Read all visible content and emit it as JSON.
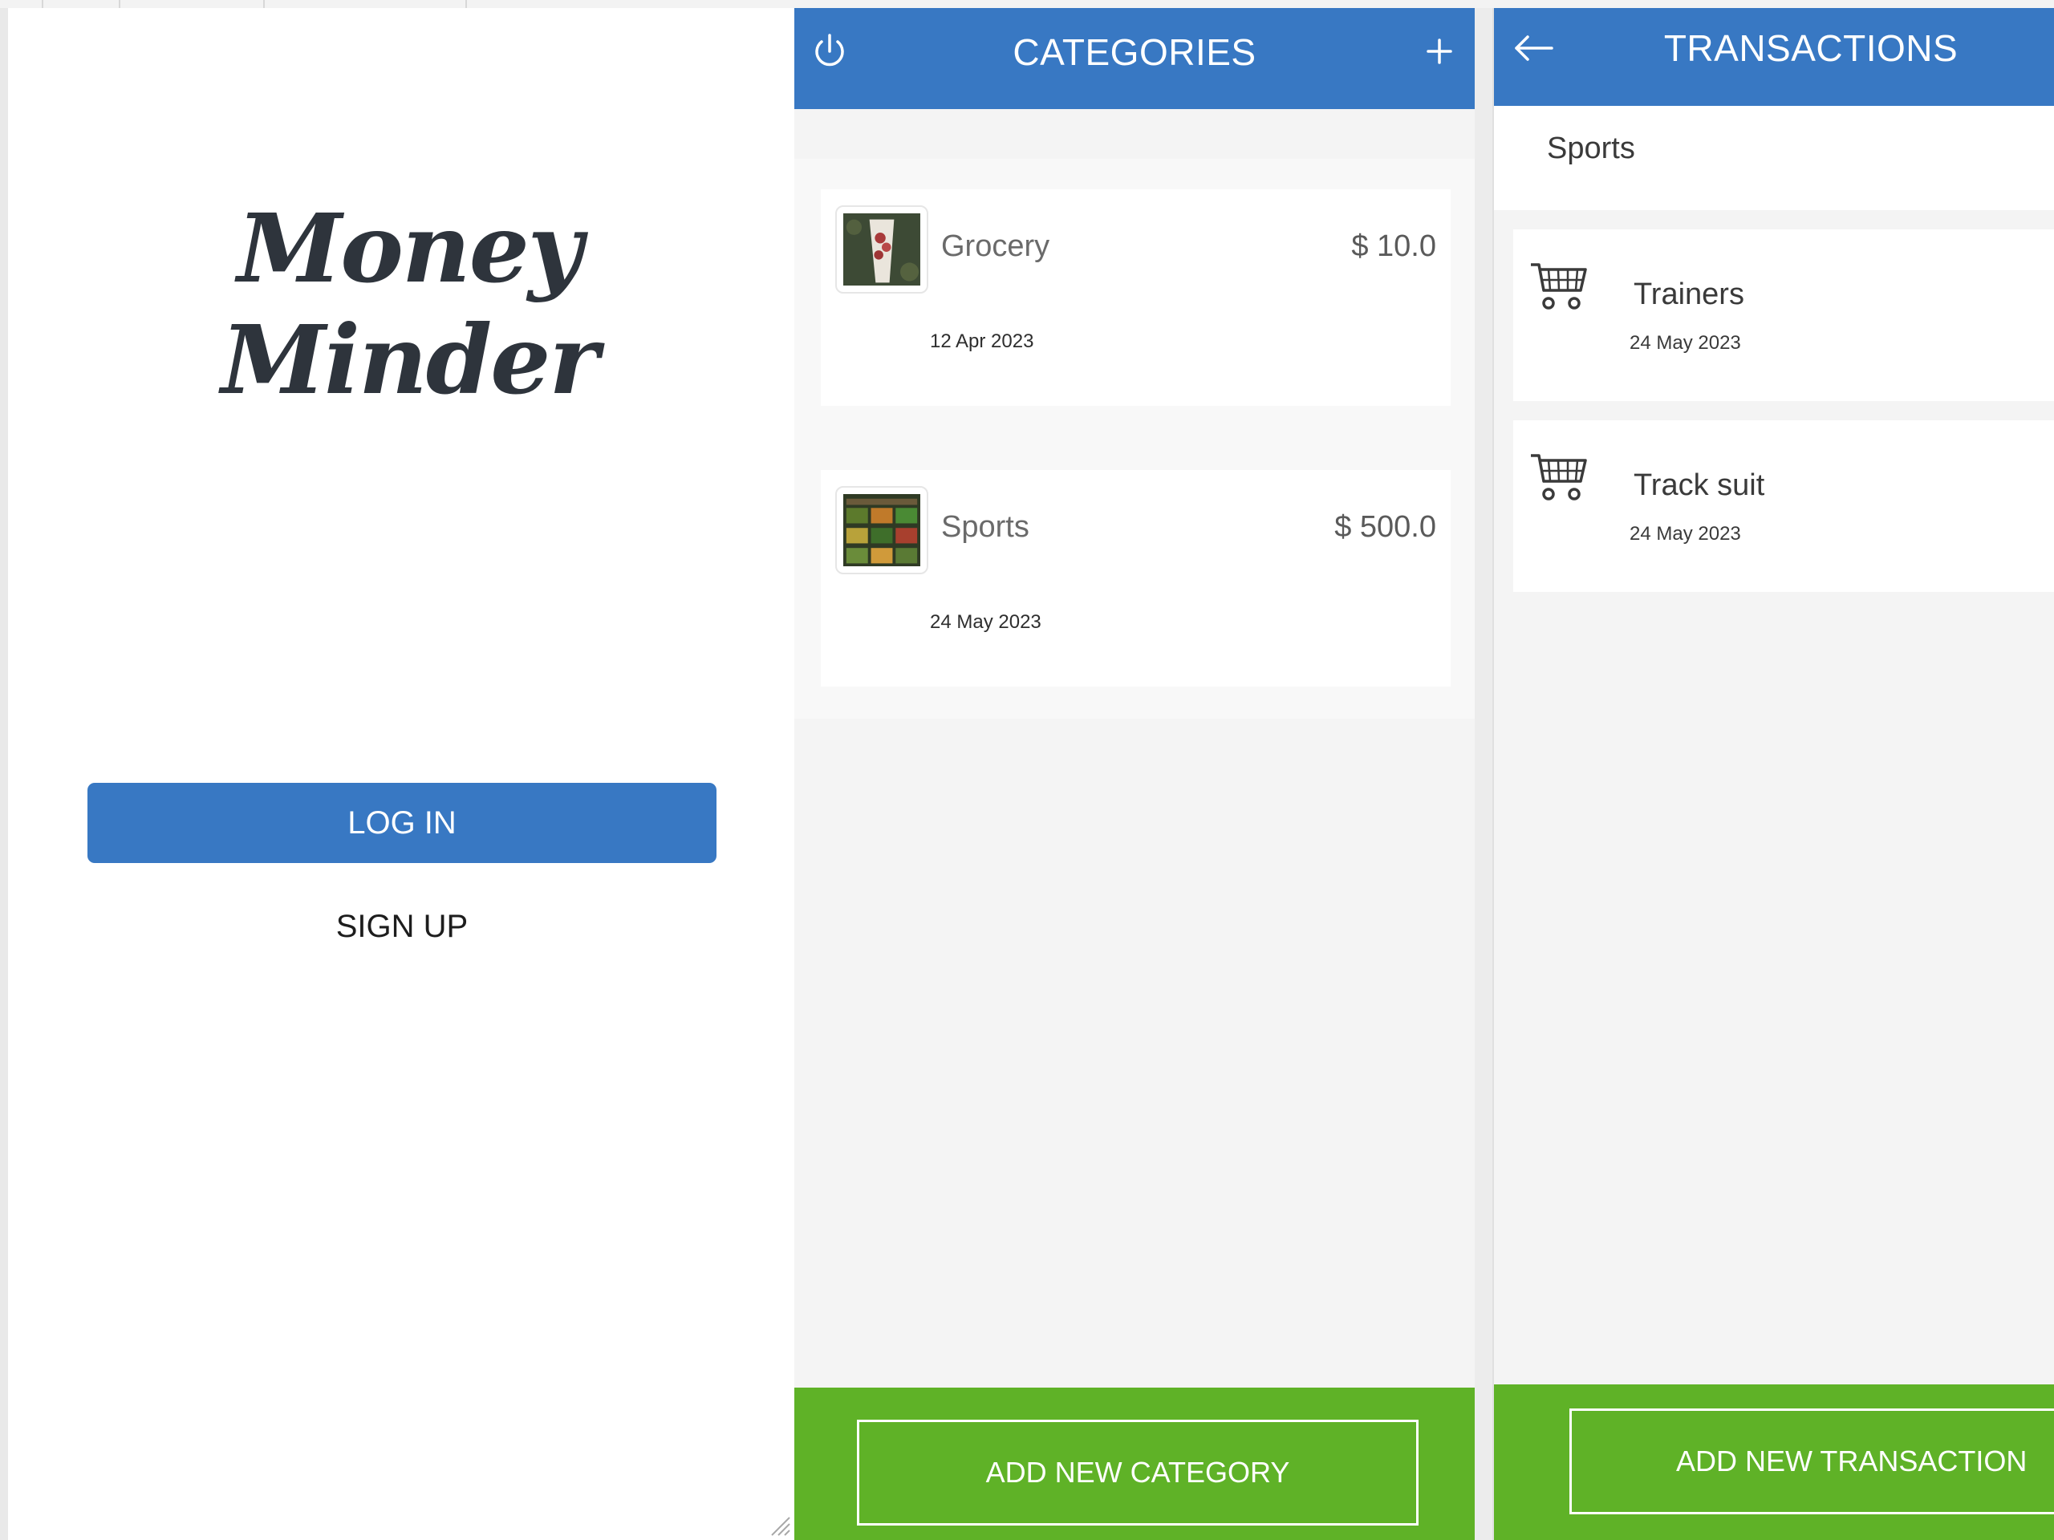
{
  "login": {
    "app_name": "Money Minder",
    "login_label": "LOG IN",
    "signup_label": "SIGN UP"
  },
  "categories": {
    "title": "CATEGORIES",
    "left_icon": "power-icon",
    "right_icon": "plus-icon",
    "items": [
      {
        "name": "Grocery",
        "amount": "$ 10.0",
        "date": "12 Apr 2023",
        "thumbnail": "flowers-photo"
      },
      {
        "name": "Sports",
        "amount": "$ 500.0",
        "date": "24 May 2023",
        "thumbnail": "produce-shelf-photo"
      }
    ],
    "add_label": "ADD NEW CATEGORY"
  },
  "transactions": {
    "title": "TRANSACTIONS",
    "left_icon": "arrow-left-icon",
    "category": "Sports",
    "items": [
      {
        "name": "Trainers",
        "date": "24 May 2023",
        "icon": "cart-icon"
      },
      {
        "name": "Track suit",
        "date": "24 May 2023",
        "icon": "cart-icon"
      }
    ],
    "add_label": "ADD NEW TRANSACTION"
  },
  "colors": {
    "header_blue": "#3878c3",
    "footer_green": "#5fb227",
    "panel_bg": "#f4f4f4",
    "text_dark": "#2e343c"
  }
}
